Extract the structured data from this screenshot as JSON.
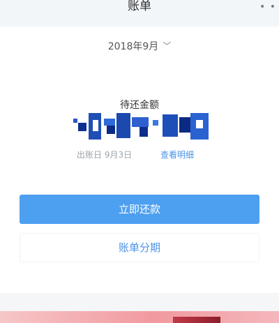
{
  "header": {
    "title": "账单",
    "more_icon": "more-dots-icon"
  },
  "bill": {
    "month": "2018年9月",
    "amount_label": "待还金额",
    "statement_text": "出账日 9月3日",
    "detail_link": "查看明细"
  },
  "actions": {
    "repay_label": "立即还款",
    "installment_label": "账单分期"
  },
  "colors": {
    "primary": "#4d9ff0",
    "link": "#4a93e6",
    "banner": "#f19a9f"
  }
}
